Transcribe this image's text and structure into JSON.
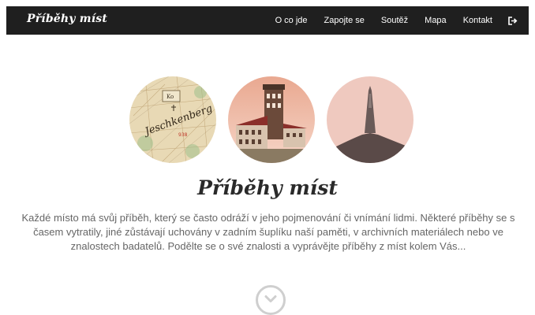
{
  "nav": {
    "brand": "Příběhy míst",
    "items": [
      {
        "label": "O co jde"
      },
      {
        "label": "Zapojte se"
      },
      {
        "label": "Soutěž"
      },
      {
        "label": "Mapa"
      },
      {
        "label": "Kontakt"
      }
    ],
    "logout_icon": "logout-icon"
  },
  "hero": {
    "images": [
      "old-map-image",
      "tower-hotel-image",
      "jested-tower-image"
    ],
    "title": "Příběhy míst",
    "description": "Každé místo má svůj příběh, který se často odráží v jeho pojmenování či vnímání lidmi. Některé příběhy se s časem vytratily, jiné zůstávají uchovány v zadním šuplíku naší paměti, v archivních materiálech nebo ve znalostech badatelů. Podělte se o své znalosti a vyprávějte příběhy z míst kolem Vás...",
    "map_label_line1": "Jeschkenberg",
    "scroll_icon": "chevron-down-circle-icon"
  },
  "colors": {
    "navbar_bg": "#1f1f1f",
    "title": "#2a2a2a",
    "text": "#666666"
  }
}
